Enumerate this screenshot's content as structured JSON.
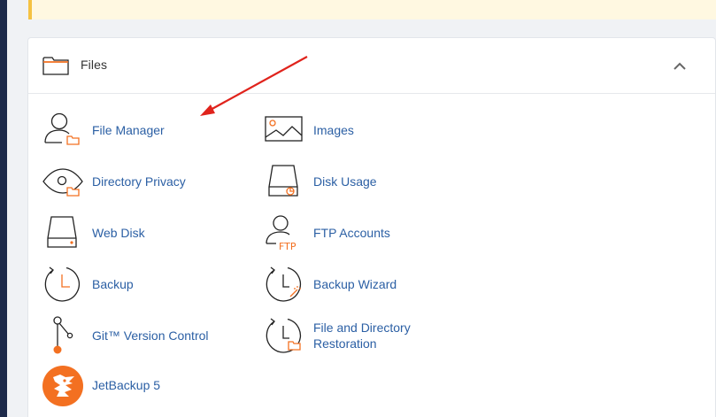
{
  "colors": {
    "accent": "#f37021",
    "link": "#2b5fa4",
    "arrow": "#e0231c",
    "icon_stroke": "#222222"
  },
  "files_section": {
    "title": "Files",
    "collapse_icon": "chevron-up-icon",
    "header_icon": "folder-icon",
    "items": [
      {
        "label": "File Manager",
        "icon": "file-manager-icon"
      },
      {
        "label": "Images",
        "icon": "images-icon"
      },
      {
        "label": "Directory Privacy",
        "icon": "directory-privacy-icon"
      },
      {
        "label": "Disk Usage",
        "icon": "disk-usage-icon"
      },
      {
        "label": "Web Disk",
        "icon": "web-disk-icon"
      },
      {
        "label": "FTP Accounts",
        "icon": "ftp-accounts-icon"
      },
      {
        "label": "Backup",
        "icon": "backup-icon"
      },
      {
        "label": "Backup Wizard",
        "icon": "backup-wizard-icon"
      },
      {
        "label": "Git™ Version Control",
        "icon": "git-icon"
      },
      {
        "label": "File and Directory",
        "label_line2": "Restoration",
        "icon": "file-restoration-icon"
      },
      {
        "label": "JetBackup 5",
        "icon": "jetbackup-icon"
      }
    ]
  },
  "annotation": {
    "icon": "red-arrow-icon"
  }
}
